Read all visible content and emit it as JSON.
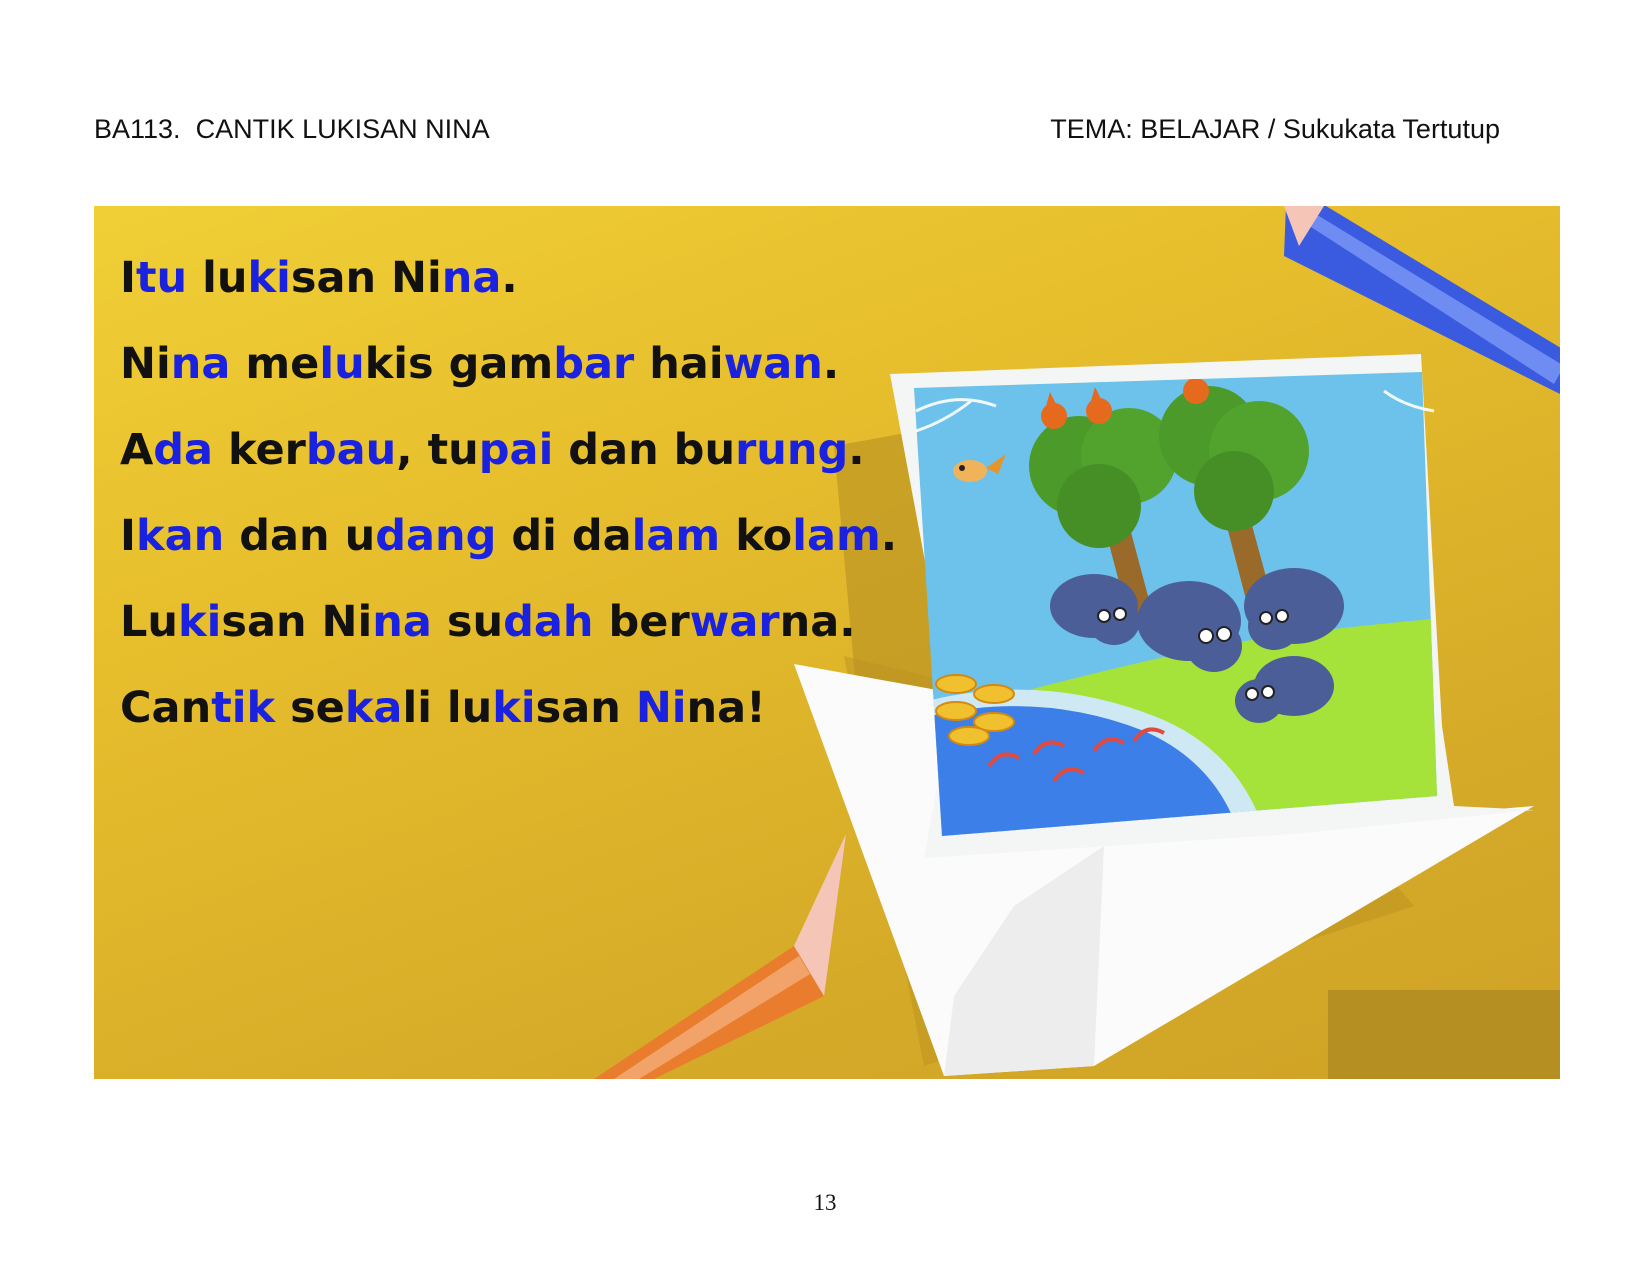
{
  "header": {
    "code_title": "BA113.  CANTIK LUKISAN NINA",
    "theme": "TEMA: BELAJAR / Sukukata Tertutup"
  },
  "story": {
    "lines": [
      [
        [
          "I",
          false
        ],
        [
          "tu",
          true
        ],
        [
          " lu",
          false
        ],
        [
          "ki",
          true
        ],
        [
          "san Ni",
          false
        ],
        [
          "na",
          true
        ],
        [
          ".",
          false
        ]
      ],
      [
        [
          "Ni",
          false
        ],
        [
          "na",
          true
        ],
        [
          " me",
          false
        ],
        [
          "lu",
          true
        ],
        [
          "kis gam",
          false
        ],
        [
          "bar",
          true
        ],
        [
          " hai",
          false
        ],
        [
          "wan",
          true
        ],
        [
          ".",
          false
        ]
      ],
      [
        [
          "A",
          false
        ],
        [
          "da",
          true
        ],
        [
          " ker",
          false
        ],
        [
          "bau",
          true
        ],
        [
          ", tu",
          false
        ],
        [
          "pai",
          true
        ],
        [
          " dan bu",
          false
        ],
        [
          "rung",
          true
        ],
        [
          ".",
          false
        ]
      ],
      [
        [
          "I",
          false
        ],
        [
          "kan",
          true
        ],
        [
          " dan u",
          false
        ],
        [
          "dang",
          true
        ],
        [
          " di da",
          false
        ],
        [
          "lam",
          true
        ],
        [
          " ko",
          false
        ],
        [
          "lam",
          true
        ],
        [
          ".",
          false
        ]
      ],
      [
        [
          "Lu",
          false
        ],
        [
          "ki",
          true
        ],
        [
          "san Ni",
          false
        ],
        [
          "na",
          true
        ],
        [
          " su",
          false
        ],
        [
          "dah",
          true
        ],
        [
          " ber",
          false
        ],
        [
          "war",
          true
        ],
        [
          "na.",
          false
        ]
      ],
      [
        [
          "Can",
          false
        ],
        [
          "tik",
          true
        ],
        [
          " se",
          false
        ],
        [
          "ka",
          true
        ],
        [
          "li lu",
          false
        ],
        [
          "ki",
          true
        ],
        [
          "san ",
          false
        ],
        [
          "Ni",
          true
        ],
        [
          "na!",
          false
        ]
      ]
    ]
  },
  "colors": {
    "background_yellow": "#e6bd2c",
    "highlight_blue": "#1a22e0",
    "text_black": "#111111"
  },
  "illustration": {
    "icons": [
      "blue-pencil-icon",
      "orange-pencil-icon",
      "animal-drawing-icon",
      "squirrel-icon",
      "bird-icon",
      "buffalo-icon",
      "fish-icon",
      "shrimp-icon",
      "tree-icon"
    ]
  },
  "footer": {
    "page_number": "13"
  }
}
